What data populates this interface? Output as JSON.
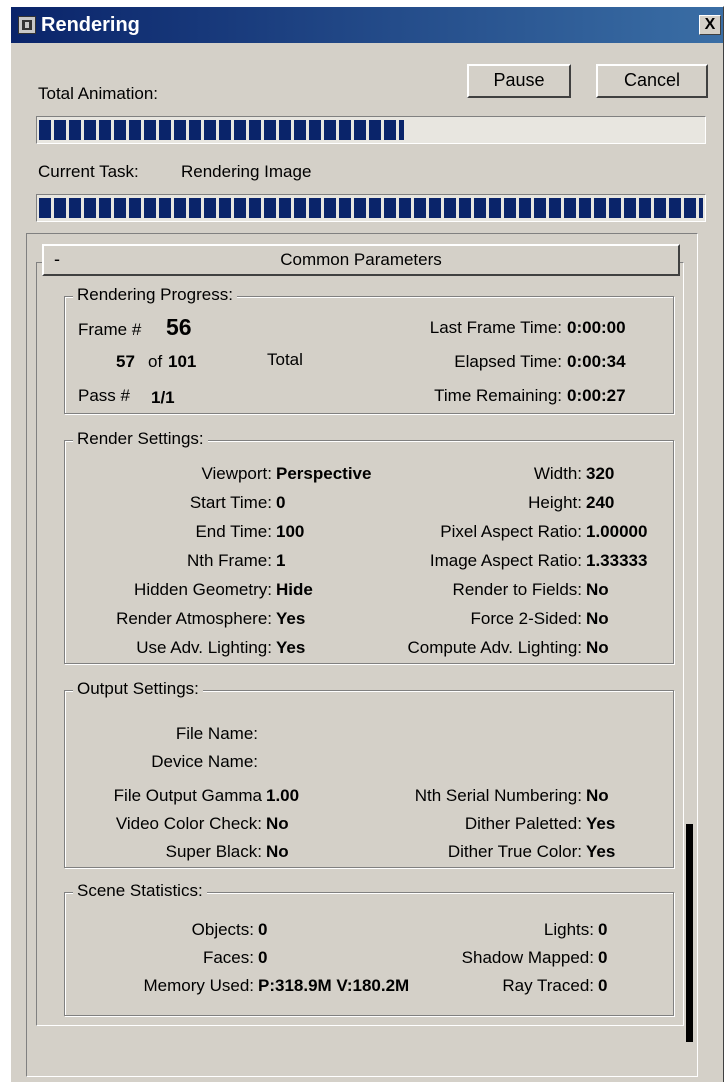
{
  "window": {
    "title": "Rendering",
    "close_glyph": "X"
  },
  "controls": {
    "pause_label": "Pause",
    "cancel_label": "Cancel"
  },
  "progress": {
    "total_label": "Total Animation:",
    "total_fraction": 0.55,
    "task_label": "Current Task:",
    "task_value": "Rendering Image",
    "task_fraction": 1.0
  },
  "colors": {
    "progress_block": "#0a246a",
    "dialog_bg": "#d4d0c8"
  },
  "rollout": {
    "collapse_glyph": "-",
    "title": "Common Parameters"
  },
  "rendering_progress": {
    "legend": "Rendering Progress:",
    "frame_label": "Frame #",
    "frame_value": "56",
    "count_current": "57",
    "count_of": "of",
    "count_total": "101",
    "total_label": "Total",
    "pass_label": "Pass #",
    "pass_value": "1/1",
    "last_frame_time_label": "Last Frame Time:",
    "last_frame_time_value": "0:00:00",
    "elapsed_label": "Elapsed Time:",
    "elapsed_value": "0:00:34",
    "remaining_label": "Time Remaining:",
    "remaining_value": "0:00:27"
  },
  "render_settings": {
    "legend": "Render Settings:",
    "left": [
      {
        "label": "Viewport:",
        "value": "Perspective"
      },
      {
        "label": "Start Time:",
        "value": "0"
      },
      {
        "label": "End Time:",
        "value": "100"
      },
      {
        "label": "Nth Frame:",
        "value": "1"
      },
      {
        "label": "Hidden Geometry:",
        "value": "Hide"
      },
      {
        "label": "Render Atmosphere:",
        "value": "Yes"
      },
      {
        "label": "Use Adv. Lighting:",
        "value": "Yes"
      }
    ],
    "right": [
      {
        "label": "Width:",
        "value": "320"
      },
      {
        "label": "Height:",
        "value": "240"
      },
      {
        "label": "Pixel Aspect Ratio:",
        "value": "1.00000"
      },
      {
        "label": "Image Aspect Ratio:",
        "value": "1.33333"
      },
      {
        "label": "Render to Fields:",
        "value": "No"
      },
      {
        "label": "Force 2-Sided:",
        "value": "No"
      },
      {
        "label": "Compute Adv. Lighting:",
        "value": "No"
      }
    ]
  },
  "output_settings": {
    "legend": "Output Settings:",
    "file_name_label": "File Name:",
    "device_name_label": "Device Name:",
    "left": [
      {
        "label": "File Output Gamma",
        "value": "1.00"
      },
      {
        "label": "Video Color Check:",
        "value": "No"
      },
      {
        "label": "Super Black:",
        "value": "No"
      }
    ],
    "right": [
      {
        "label": "Nth Serial Numbering:",
        "value": "No"
      },
      {
        "label": "Dither Paletted:",
        "value": "Yes"
      },
      {
        "label": "Dither True Color:",
        "value": "Yes"
      }
    ]
  },
  "scene_statistics": {
    "legend": "Scene Statistics:",
    "left": [
      {
        "label": "Objects:",
        "value": "0"
      },
      {
        "label": "Faces:",
        "value": "0"
      },
      {
        "label": "Memory Used:",
        "value": "P:318.9M V:180.2M"
      }
    ],
    "right": [
      {
        "label": "Lights:",
        "value": "0"
      },
      {
        "label": "Shadow Mapped:",
        "value": "0"
      },
      {
        "label": "Ray Traced:",
        "value": "0"
      }
    ]
  }
}
